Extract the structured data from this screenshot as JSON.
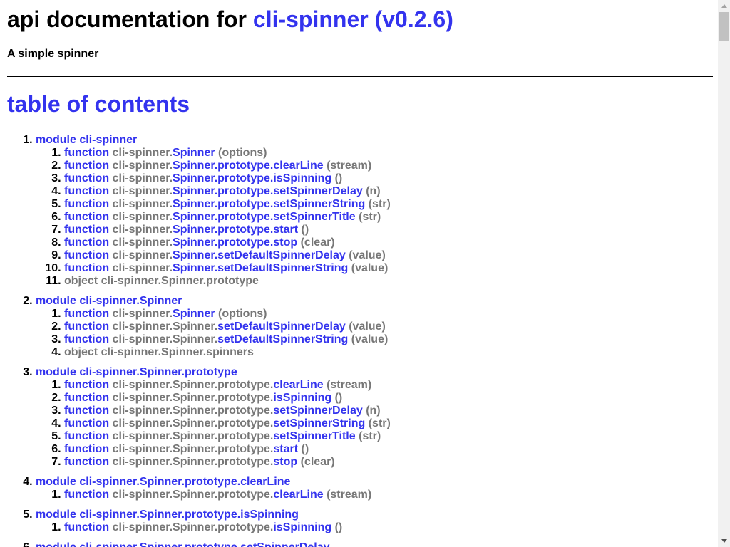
{
  "header": {
    "title_prefix": "api documentation for ",
    "title_link": "cli-spinner (v0.2.6)",
    "subtitle": "A simple spinner"
  },
  "toc": {
    "heading": "table of contents",
    "modules": [
      {
        "keyword": "module",
        "name": "cli-spinner",
        "items": [
          {
            "kw": "function",
            "prefix": "cli-spinner.",
            "name": "Spinner",
            "args": "(options)"
          },
          {
            "kw": "function",
            "prefix": "cli-spinner.",
            "name": "Spinner.prototype.clearLine",
            "args": "(stream)"
          },
          {
            "kw": "function",
            "prefix": "cli-spinner.",
            "name": "Spinner.prototype.isSpinning",
            "args": "()"
          },
          {
            "kw": "function",
            "prefix": "cli-spinner.",
            "name": "Spinner.prototype.setSpinnerDelay",
            "args": "(n)"
          },
          {
            "kw": "function",
            "prefix": "cli-spinner.",
            "name": "Spinner.prototype.setSpinnerString",
            "args": "(str)"
          },
          {
            "kw": "function",
            "prefix": "cli-spinner.",
            "name": "Spinner.prototype.setSpinnerTitle",
            "args": "(str)"
          },
          {
            "kw": "function",
            "prefix": "cli-spinner.",
            "name": "Spinner.prototype.start",
            "args": "()"
          },
          {
            "kw": "function",
            "prefix": "cli-spinner.",
            "name": "Spinner.prototype.stop",
            "args": "(clear)"
          },
          {
            "kw": "function",
            "prefix": "cli-spinner.",
            "name": "Spinner.setDefaultSpinnerDelay",
            "args": "(value)"
          },
          {
            "kw": "function",
            "prefix": "cli-spinner.",
            "name": "Spinner.setDefaultSpinnerString",
            "args": "(value)"
          },
          {
            "kw": "object",
            "prefix": "cli-spinner.Spinner.prototype",
            "name": "",
            "args": ""
          }
        ]
      },
      {
        "keyword": "module",
        "name": "cli-spinner.Spinner",
        "items": [
          {
            "kw": "function",
            "prefix": "cli-spinner.",
            "name": "Spinner",
            "args": "(options)"
          },
          {
            "kw": "function",
            "prefix": "cli-spinner.Spinner.",
            "name": "setDefaultSpinnerDelay",
            "args": "(value)"
          },
          {
            "kw": "function",
            "prefix": "cli-spinner.Spinner.",
            "name": "setDefaultSpinnerString",
            "args": "(value)"
          },
          {
            "kw": "object",
            "prefix": "cli-spinner.Spinner.spinners",
            "name": "",
            "args": ""
          }
        ]
      },
      {
        "keyword": "module",
        "name": "cli-spinner.Spinner.prototype",
        "items": [
          {
            "kw": "function",
            "prefix": "cli-spinner.Spinner.prototype.",
            "name": "clearLine",
            "args": "(stream)"
          },
          {
            "kw": "function",
            "prefix": "cli-spinner.Spinner.prototype.",
            "name": "isSpinning",
            "args": "()"
          },
          {
            "kw": "function",
            "prefix": "cli-spinner.Spinner.prototype.",
            "name": "setSpinnerDelay",
            "args": "(n)"
          },
          {
            "kw": "function",
            "prefix": "cli-spinner.Spinner.prototype.",
            "name": "setSpinnerString",
            "args": "(str)"
          },
          {
            "kw": "function",
            "prefix": "cli-spinner.Spinner.prototype.",
            "name": "setSpinnerTitle",
            "args": "(str)"
          },
          {
            "kw": "function",
            "prefix": "cli-spinner.Spinner.prototype.",
            "name": "start",
            "args": "()"
          },
          {
            "kw": "function",
            "prefix": "cli-spinner.Spinner.prototype.",
            "name": "stop",
            "args": "(clear)"
          }
        ]
      },
      {
        "keyword": "module",
        "name": "cli-spinner.Spinner.prototype.clearLine",
        "items": [
          {
            "kw": "function",
            "prefix": "cli-spinner.Spinner.prototype.",
            "name": "clearLine",
            "args": "(stream)"
          }
        ]
      },
      {
        "keyword": "module",
        "name": "cli-spinner.Spinner.prototype.isSpinning",
        "items": [
          {
            "kw": "function",
            "prefix": "cli-spinner.Spinner.prototype.",
            "name": "isSpinning",
            "args": "()"
          }
        ]
      },
      {
        "keyword": "module",
        "name": "cli-spinner.Spinner.prototype.setSpinnerDelay",
        "items": []
      }
    ]
  },
  "colors": {
    "link": "#3333ee",
    "muted": "#777777",
    "text": "#000000"
  }
}
